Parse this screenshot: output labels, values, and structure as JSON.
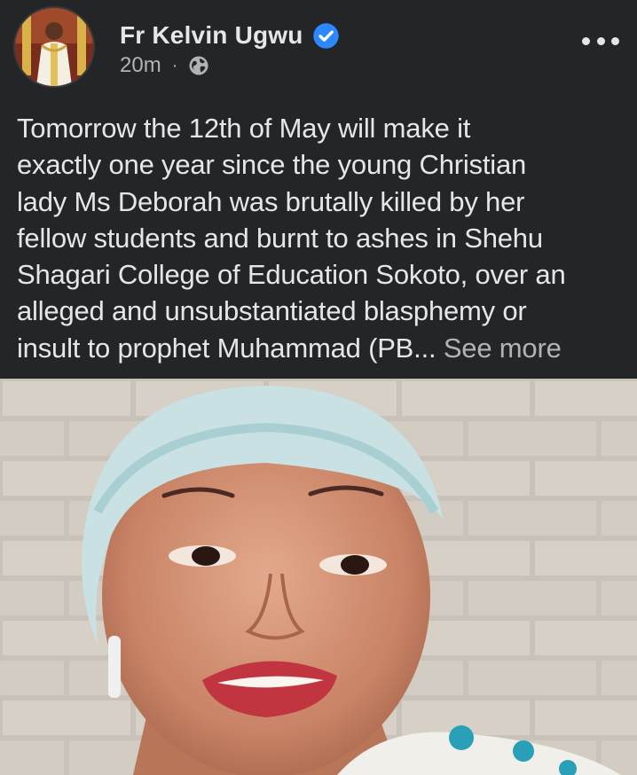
{
  "author": {
    "name": "Fr Kelvin Ugwu",
    "verified_icon": "verified-badge-icon",
    "avatar_icon": "profile-photo"
  },
  "meta": {
    "time": "20m",
    "separator": "·",
    "audience_icon": "globe-icon"
  },
  "actions": {
    "more_icon": "more-options-icon"
  },
  "post": {
    "lines": [
      "Tomorrow the 12th of May will make it",
      "exactly one year since the young Christian",
      "lady Ms Deborah was brutally killed by her",
      "fellow students and burnt to ashes in Shehu",
      "Shagari College of Education Sokoto, over an",
      "alleged and unsubstantiated blasphemy or",
      "insult to prophet Muhammad (PB..."
    ],
    "see_more": "See more"
  },
  "photo": {
    "subject": "portrait-photo"
  },
  "colors": {
    "background": "#242526",
    "primary_text": "#e4e6eb",
    "secondary_text": "#b0b3b8",
    "verified_blue": "#2d88ff"
  }
}
